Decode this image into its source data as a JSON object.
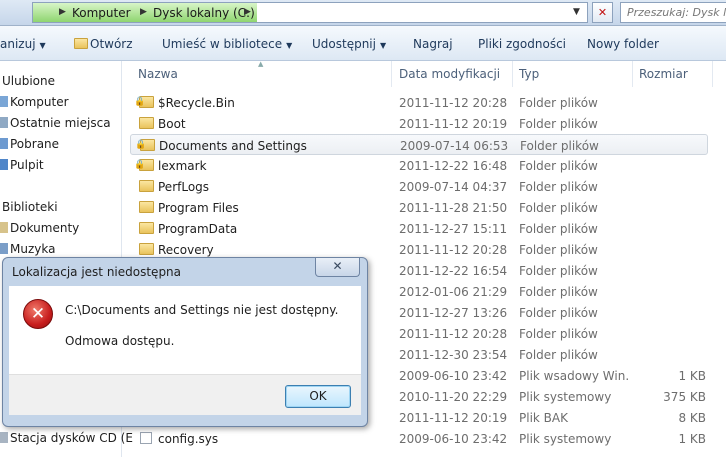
{
  "address": {
    "crumbs": [
      "Komputer",
      "Dysk lokalny (C:)"
    ],
    "search_placeholder": "Przeszukaj: Dysk lo"
  },
  "toolbar": {
    "organize": "anizuj",
    "open": "Otwórz",
    "library": "Umieść w bibliotece",
    "share": "Udostępnij",
    "burn": "Nagraj",
    "compat": "Pliki zgodności",
    "new_folder": "Nowy folder"
  },
  "nav": {
    "favorites_header": "Ulubione",
    "favorites": [
      "Komputer",
      "Ostatnie miejsca",
      "Pobrane",
      "Pulpit"
    ],
    "libraries_header": "Biblioteki",
    "libraries": [
      "Dokumenty",
      "Muzyka"
    ],
    "drive": "Stacja dysków CD (E"
  },
  "columns": {
    "name": "Nazwa",
    "date": "Data modyfikacji",
    "type": "Typ",
    "size": "Rozmiar"
  },
  "files": [
    {
      "name": "$Recycle.Bin",
      "date": "2011-11-12 20:28",
      "type": "Folder plików",
      "size": "",
      "icon": "locked-folder"
    },
    {
      "name": "Boot",
      "date": "2011-11-12 20:19",
      "type": "Folder plików",
      "size": "",
      "icon": "folder"
    },
    {
      "name": "Documents and Settings",
      "date": "2009-07-14 06:53",
      "type": "Folder plików",
      "size": "",
      "icon": "locked-folder"
    },
    {
      "name": "lexmark",
      "date": "2011-12-22 16:48",
      "type": "Folder plików",
      "size": "",
      "icon": "locked-folder"
    },
    {
      "name": "PerfLogs",
      "date": "2009-07-14 04:37",
      "type": "Folder plików",
      "size": "",
      "icon": "folder"
    },
    {
      "name": "Program Files",
      "date": "2011-11-28 21:50",
      "type": "Folder plików",
      "size": "",
      "icon": "folder"
    },
    {
      "name": "ProgramData",
      "date": "2011-12-27 15:11",
      "type": "Folder plików",
      "size": "",
      "icon": "folder"
    },
    {
      "name": "Recovery",
      "date": "2011-11-12 20:28",
      "type": "Folder plików",
      "size": "",
      "icon": "folder"
    },
    {
      "name": "",
      "date": "2011-12-22 16:54",
      "type": "Folder plików",
      "size": "",
      "icon": "folder"
    },
    {
      "name": "",
      "date": "2012-01-06 21:29",
      "type": "Folder plików",
      "size": "",
      "icon": "folder"
    },
    {
      "name": "",
      "date": "2011-12-27 13:26",
      "type": "Folder plików",
      "size": "",
      "icon": "folder"
    },
    {
      "name": "",
      "date": "2011-11-12 20:28",
      "type": "Folder plików",
      "size": "",
      "icon": "folder"
    },
    {
      "name": "",
      "date": "2011-12-30 23:54",
      "type": "Folder plików",
      "size": "",
      "icon": "folder"
    },
    {
      "name": "",
      "date": "2009-06-10 23:42",
      "type": "Plik wsadowy Win...",
      "size": "1 KB",
      "icon": "file"
    },
    {
      "name": "",
      "date": "2010-11-20 22:29",
      "type": "Plik systemowy",
      "size": "375 KB",
      "icon": "file"
    },
    {
      "name": "",
      "date": "2011-11-12 20:19",
      "type": "Plik BAK",
      "size": "8 KB",
      "icon": "file"
    },
    {
      "name": "config.sys",
      "date": "2009-06-10 23:42",
      "type": "Plik systemowy",
      "size": "1 KB",
      "icon": "file"
    }
  ],
  "dialog": {
    "title": "Lokalizacja jest niedostępna",
    "close": "✕",
    "message": "C:\\Documents and Settings nie jest dostępny.",
    "detail": "Odmowa dostępu.",
    "ok": "OK"
  }
}
